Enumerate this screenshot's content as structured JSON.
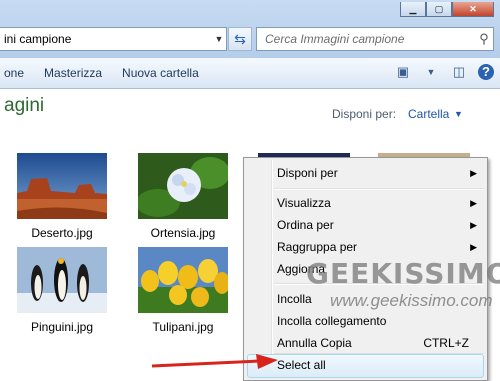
{
  "addressbar": {
    "path": "ini campione"
  },
  "search": {
    "placeholder": "Cerca Immagini campione"
  },
  "toolbar": {
    "items": [
      "one",
      "Masterizza",
      "Nuova cartella"
    ]
  },
  "library": {
    "title": "agini",
    "arrange_label": "Disponi per:",
    "arrange_value": "Cartella"
  },
  "files": [
    {
      "name": "Deserto.jpg"
    },
    {
      "name": "Ortensia.jpg"
    },
    {
      "name": "Pinguini.jpg"
    },
    {
      "name": "Tulipani.jpg"
    }
  ],
  "context_menu": {
    "items": [
      {
        "label": "Disponi per"
      },
      {
        "label": "Visualizza"
      },
      {
        "label": "Ordina per"
      },
      {
        "label": "Raggruppa per"
      },
      {
        "label": "Aggiorna"
      },
      {
        "label": "Incolla"
      },
      {
        "label": "Incolla collegamento"
      },
      {
        "label": "Annulla Copia",
        "shortcut": "CTRL+Z"
      },
      {
        "label": "Select all"
      }
    ]
  },
  "watermark": {
    "logo": "GEEKISSIMO",
    "url": "www.geekissimo.com"
  },
  "colors": {
    "annotation_arrow": "#d9241c",
    "library_title": "#2b6b2f"
  }
}
